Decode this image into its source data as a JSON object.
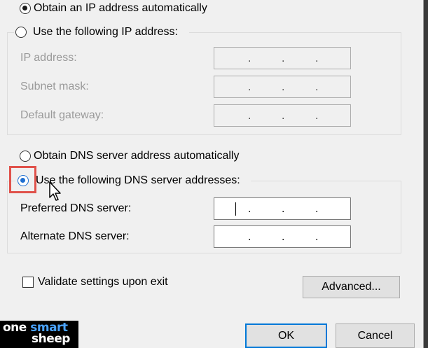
{
  "ip_section": {
    "obtain_auto_label": "Obtain an IP address automatically",
    "use_following_label": "Use the following IP address:",
    "fields": [
      {
        "label": "IP address:"
      },
      {
        "label": "Subnet mask:"
      },
      {
        "label": "Default gateway:"
      }
    ]
  },
  "dns_section": {
    "obtain_auto_label": "Obtain DNS server address automatically",
    "use_following_label": "Use the following DNS server addresses:",
    "fields": [
      {
        "label": "Preferred DNS server:"
      },
      {
        "label": "Alternate DNS server:"
      }
    ]
  },
  "options": {
    "validate_label": "Validate settings upon exit"
  },
  "buttons": {
    "advanced_label": "Advanced...",
    "ok_label": "OK",
    "cancel_label": "Cancel"
  },
  "logo": {
    "line1_part1": "one",
    "line1_part2": "smart",
    "line2": "sheep"
  },
  "colors": {
    "highlight": "#e0524b",
    "selected_radio": "#1f6fd1",
    "default_button_border": "#0078d7"
  },
  "state": {
    "ip_mode": "obtain_automatically",
    "dns_mode": "use_following",
    "validate_checked": false
  }
}
